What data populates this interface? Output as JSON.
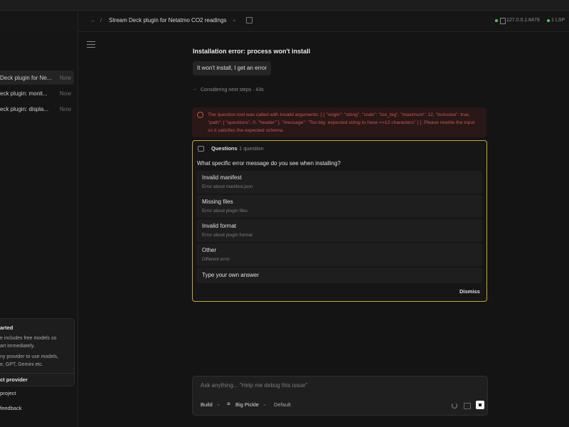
{
  "topbar": {
    "back_arrow": "←",
    "separator": "/",
    "title": "Stream Deck plugin for Netatmo CO2 readings",
    "title_chevron": "⌄",
    "server": "127.0.0.1:8478",
    "lsp": "1 LSP",
    "status_color": "#3ccf5f"
  },
  "sidebar": {
    "sessions": [
      {
        "title": "Deck plugin for Ne...",
        "time": "Now",
        "active": true
      },
      {
        "title": "eck plugin: monit...",
        "time": "Now",
        "active": false
      },
      {
        "title": "eck plugin: displa...",
        "time": "Now",
        "active": false
      }
    ],
    "get_started": {
      "title": "arted",
      "line1": "e includes free models so",
      "line2": "art immediately.",
      "line3": "ny provider to use models,",
      "line4": "e, GPT, Gemini etc.",
      "cta": "ct provider"
    },
    "links": [
      "project",
      "feedback"
    ]
  },
  "main": {
    "heading": "Installation error: process won't install",
    "user_message": "It won't install, I get an error",
    "thinking": "Considering next steps · 43s",
    "error_text": "The question tool was called with invalid arguments: [ { \"origin\": \"string\", \"code\": \"too_big\", \"maximum\": 12, \"inclusive\": true, \"path\": [ \"questions\", 0, \"header\" ], \"message\": \"Too big: expected string to have <=12 characters\" } ]. Please rewrite the input so it satisfies the expected schema.",
    "questions": {
      "label": "Questions",
      "count": "1 question",
      "prompt": "What specific error message do you see when installing?",
      "options": [
        {
          "label": "Invalid manifest",
          "desc": "Error about manifest.json"
        },
        {
          "label": "Missing files",
          "desc": "Error about plugin files"
        },
        {
          "label": "Invalid format",
          "desc": "Error about plugin format"
        },
        {
          "label": "Other",
          "desc": "Different error"
        }
      ],
      "custom": "Type your own answer",
      "dismiss": "Dismiss"
    }
  },
  "composer": {
    "placeholder": "Ask anything... \"Help me debug this issue\"",
    "mode": "Build",
    "model": "Big Pickle",
    "variant": "Default"
  },
  "colors": {
    "accent": "#c8a733",
    "error": "#c75a52",
    "bg": "#141414"
  }
}
